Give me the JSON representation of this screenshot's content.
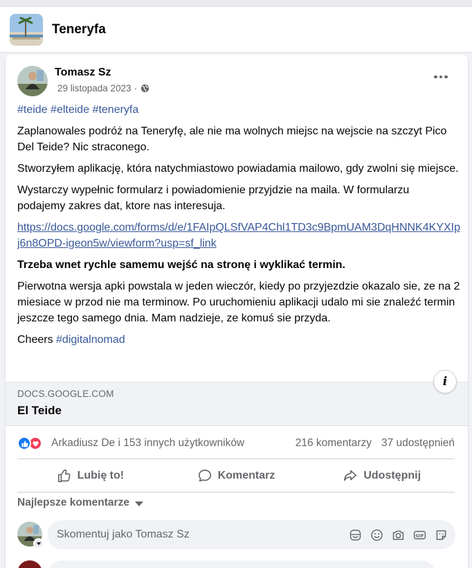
{
  "group": {
    "name": "Teneryfa"
  },
  "post": {
    "author": "Tomasz Sz",
    "date": "29 listopada 2023",
    "dot": "·",
    "tags": [
      "#teide",
      "#elteide",
      "#teneryfa"
    ],
    "paragraphs": [
      "Zaplanowales podróż na Teneryfę, ale nie ma wolnych miejsc na wejscie na szczyt Pico Del Teide? Nic straconego.",
      "Stworzyłem aplikację, która natychmiastowo powiadamia mailowo, gdy zwolni się miejsce.",
      "Wystarczy wypełnic formularz i powiadomienie przyjdzie na maila. W formularzu podajemy zakres dat, ktore nas interesuja."
    ],
    "url": "https://docs.google.com/forms/d/e/1FAIpQLSfVAP4Chl1TD3c9BpmUAM3DqHNNK4KYXIpj6n8OPD-igeon5w/viewform?usp=sf_link",
    "bold_text": "Trzeba wnet rychle samemu wejść na stronę i wyklikać termin.",
    "paragraph_after": "Pierwotna wersja apki powstala w jeden wieczór, kiedy po przyjezdzie okazalo sie, ze na 2 miesiace w przod nie ma terminow. Po uruchomieniu aplikacji udalo mi sie znaleźć termin jeszcze tego samego dnia. Mam nadzieje, ze komuś sie przyda.",
    "closing_word": "Cheers",
    "closing_tag": "#digitalnomad"
  },
  "link_preview": {
    "domain": "DOCS.GOOGLE.COM",
    "title": "El Teide",
    "info_icon": "i"
  },
  "reactions": {
    "names": "Arkadiusz De i 153 innych użytkowników",
    "comments": "216 komentarzy",
    "shares": "37 udostępnień"
  },
  "actions": {
    "like": "Lubię to!",
    "comment": "Komentarz",
    "share": "Udostępnij"
  },
  "comments": {
    "sort_label": "Najlepsze komentarze",
    "placeholder": "Skomentuj jako Tomasz Sz"
  },
  "colors": {
    "link": "#385898",
    "like_blue": "#1877f2",
    "love_red": "#f33e58",
    "muted": "#65676b"
  },
  "icons": [
    "globe-icon",
    "more-icon",
    "info-icon",
    "like-reaction-icon",
    "love-reaction-icon",
    "thumbs-up-icon",
    "comment-icon",
    "share-icon",
    "chevron-down-icon",
    "sticker-icon",
    "emoji-icon",
    "camera-icon",
    "gif-icon",
    "avatar-sticker-icon"
  ]
}
